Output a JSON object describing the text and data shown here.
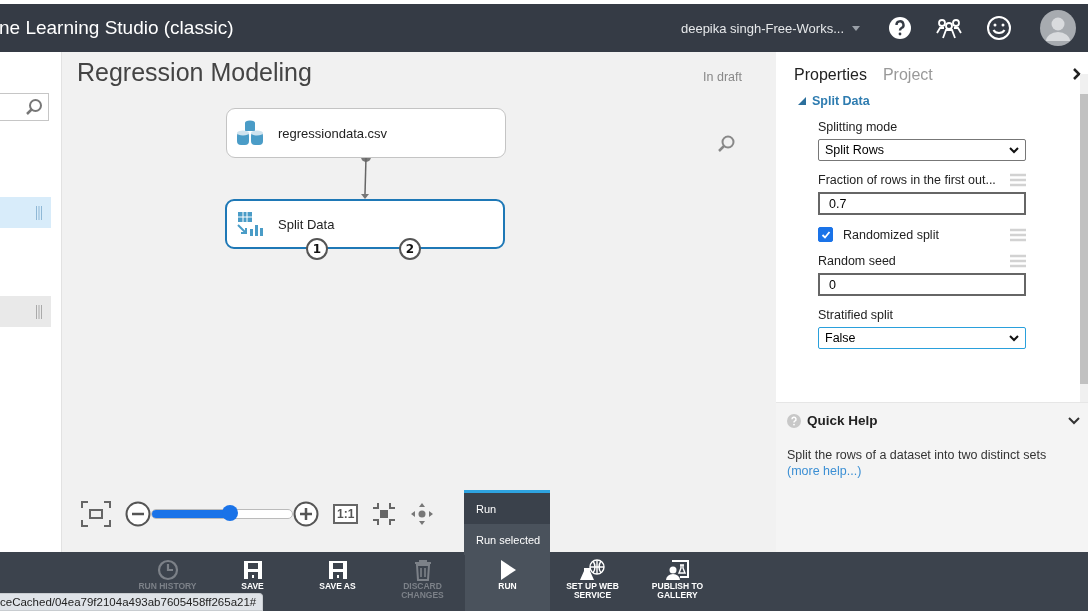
{
  "header": {
    "title": "ne Learning Studio (classic)",
    "account": "deepika singh-Free-Works..."
  },
  "sidebar": {
    "items": [
      {
        "selected": true
      },
      {
        "selected": false
      }
    ]
  },
  "canvas": {
    "title": "Regression Modeling",
    "status": "In draft",
    "nodes": [
      {
        "kind": "dataset",
        "label": "regressiondata.csv",
        "selected": false
      },
      {
        "kind": "module",
        "label": "Split Data",
        "selected": true,
        "ports": [
          "1",
          "2"
        ]
      }
    ],
    "zoom": {
      "level": 0.56
    },
    "fit_label": "1:1"
  },
  "properties": {
    "tabs": [
      {
        "label": "Properties",
        "selected": true
      },
      {
        "label": "Project",
        "selected": false
      }
    ],
    "section": "Split Data",
    "fields": [
      {
        "kind": "select",
        "label": "Splitting mode",
        "value": "Split Rows",
        "focused": false,
        "grip": false
      },
      {
        "kind": "input",
        "label": "Fraction of rows in the first out...",
        "value": "0.7",
        "grip": true
      },
      {
        "kind": "checkbox",
        "label": "Randomized split",
        "checked": true,
        "grip": true
      },
      {
        "kind": "input",
        "label": "Random seed",
        "value": "0",
        "grip": true
      },
      {
        "kind": "select",
        "label": "Stratified split",
        "value": "False",
        "focused": true,
        "grip": false
      }
    ]
  },
  "quick_help": {
    "title": "Quick Help",
    "text": "Split the rows of a dataset into two distinct sets",
    "link": "(more help...)"
  },
  "run_menu": {
    "items": [
      {
        "label": "Run",
        "selected": true
      },
      {
        "label": "Run selected",
        "selected": false
      }
    ]
  },
  "toolbar": {
    "buttons": [
      {
        "kind": "history",
        "label": "RUN HISTORY",
        "disabled": true,
        "selected": false
      },
      {
        "kind": "save",
        "label": "SAVE",
        "disabled": false,
        "selected": false
      },
      {
        "kind": "save",
        "label": "SAVE AS",
        "disabled": false,
        "selected": false
      },
      {
        "kind": "discard",
        "label": "DISCARD CHANGES",
        "disabled": true,
        "selected": false
      },
      {
        "kind": "run",
        "label": "RUN",
        "disabled": false,
        "selected": true
      },
      {
        "kind": "web",
        "label": "SET UP WEB SERVICE",
        "disabled": false,
        "selected": false
      },
      {
        "kind": "publish",
        "label": "PUBLISH TO GALLERY",
        "disabled": false,
        "selected": false
      }
    ]
  },
  "status_url": "ceCached/04ea79f2104a493ab7605458ff265a21#"
}
